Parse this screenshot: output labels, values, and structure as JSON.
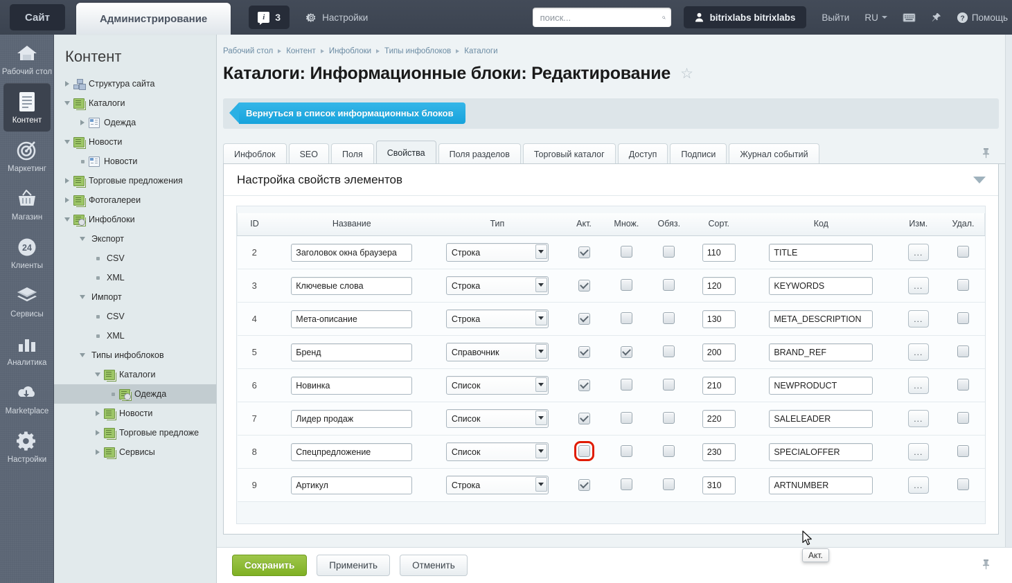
{
  "topbar": {
    "site_tab": "Сайт",
    "admin_tab": "Администрирование",
    "notif_count": "3",
    "notif_icon": "info-badge-icon",
    "settings_label": "Настройки",
    "settings_icon": "gear-icon",
    "search_placeholder": "поиск...",
    "search_value": "",
    "search_icon": "search-icon",
    "user_name": "bitrixlabs bitrixlabs",
    "user_icon": "user-icon",
    "logout_label": "Выйти",
    "lang_label": "RU",
    "keyboard_icon": "keyboard-icon",
    "pin_icon": "pin-icon",
    "help_label": "Помощь",
    "help_icon": "question-circle-icon"
  },
  "rail": {
    "items": [
      {
        "label": "Рабочий стол",
        "icon": "home-icon",
        "selected": false
      },
      {
        "label": "Контент",
        "icon": "document-icon",
        "selected": true
      },
      {
        "label": "Маркетинг",
        "icon": "target-icon",
        "selected": false
      },
      {
        "label": "Магазин",
        "icon": "basket-icon",
        "selected": false
      },
      {
        "label": "Клиенты",
        "icon": "badge-24-icon",
        "selected": false
      },
      {
        "label": "Сервисы",
        "icon": "layers-icon",
        "selected": false
      },
      {
        "label": "Аналитика",
        "icon": "bar-chart-icon",
        "selected": false
      },
      {
        "label": "Marketplace",
        "icon": "cloud-download-icon",
        "selected": false
      },
      {
        "label": "Настройки",
        "icon": "gear-icon",
        "selected": false
      }
    ]
  },
  "sidebar": {
    "title": "Контент",
    "nodes": [
      {
        "label": "Структура сайта",
        "indent": 0,
        "marker": "right",
        "icon": "site-structure-icon",
        "selected": false
      },
      {
        "label": "Каталоги",
        "indent": 0,
        "marker": "down",
        "icon": "green-folder-icon",
        "selected": false
      },
      {
        "label": "Одежда",
        "indent": 1,
        "marker": "right",
        "icon": "page-icon",
        "selected": false
      },
      {
        "label": "Новости",
        "indent": 0,
        "marker": "down",
        "icon": "green-folder-icon",
        "selected": false
      },
      {
        "label": "Новости",
        "indent": 1,
        "marker": "dot",
        "icon": "page-icon",
        "selected": false
      },
      {
        "label": "Торговые предложения",
        "indent": 0,
        "marker": "right",
        "icon": "green-folder-icon",
        "selected": false
      },
      {
        "label": "Фотогалереи",
        "indent": 0,
        "marker": "right",
        "icon": "green-folder-icon",
        "selected": false
      },
      {
        "label": "Инфоблоки",
        "indent": 0,
        "marker": "down",
        "icon": "green-folder-gear-icon",
        "selected": false
      },
      {
        "label": "Экспорт",
        "indent": 1,
        "marker": "down",
        "icon": "none",
        "selected": false
      },
      {
        "label": "CSV",
        "indent": 2,
        "marker": "dot",
        "icon": "none",
        "selected": false
      },
      {
        "label": "XML",
        "indent": 2,
        "marker": "dot",
        "icon": "none",
        "selected": false
      },
      {
        "label": "Импорт",
        "indent": 1,
        "marker": "down",
        "icon": "none",
        "selected": false
      },
      {
        "label": "CSV",
        "indent": 2,
        "marker": "dot",
        "icon": "none",
        "selected": false
      },
      {
        "label": "XML",
        "indent": 2,
        "marker": "dot",
        "icon": "none",
        "selected": false
      },
      {
        "label": "Типы инфоблоков",
        "indent": 1,
        "marker": "down",
        "icon": "none",
        "selected": false
      },
      {
        "label": "Каталоги",
        "indent": 2,
        "marker": "down",
        "icon": "green-folder-icon",
        "selected": false
      },
      {
        "label": "Одежда",
        "indent": 3,
        "marker": "dot",
        "icon": "green-folder-gear-icon",
        "selected": true
      },
      {
        "label": "Новости",
        "indent": 2,
        "marker": "right",
        "icon": "green-folder-icon",
        "selected": false
      },
      {
        "label": "Торговые предложе",
        "indent": 2,
        "marker": "right",
        "icon": "green-folder-icon",
        "selected": false
      },
      {
        "label": "Сервисы",
        "indent": 2,
        "marker": "right",
        "icon": "green-folder-icon",
        "selected": false
      }
    ]
  },
  "breadcrumbs": [
    "Рабочий стол",
    "Контент",
    "Инфоблоки",
    "Типы инфоблоков",
    "Каталоги"
  ],
  "page": {
    "title": "Каталоги: Информационные блоки: Редактирование",
    "favorite_icon": "star-outline-icon",
    "back_button": "Вернуться в список информационных блоков",
    "pin_icon": "pin-icon"
  },
  "tabs": [
    {
      "label": "Инфоблок",
      "active": false
    },
    {
      "label": "SEO",
      "active": false
    },
    {
      "label": "Поля",
      "active": false
    },
    {
      "label": "Свойства",
      "active": true
    },
    {
      "label": "Поля разделов",
      "active": false
    },
    {
      "label": "Торговый каталог",
      "active": false
    },
    {
      "label": "Доступ",
      "active": false
    },
    {
      "label": "Подписи",
      "active": false
    },
    {
      "label": "Журнал событий",
      "active": false
    }
  ],
  "card": {
    "title": "Настройка свойств элементов",
    "collapse_icon": "chevron-down-icon"
  },
  "table": {
    "headers": [
      "ID",
      "Название",
      "Тип",
      "Акт.",
      "Множ.",
      "Обяз.",
      "Сорт.",
      "Код",
      "Изм.",
      "Удал."
    ],
    "edit_button_label": "...",
    "rows": [
      {
        "id": "2",
        "name": "Заголовок окна браузера",
        "type": "Строка",
        "active": true,
        "multiple": false,
        "required": false,
        "sort": "110",
        "code": "TITLE",
        "delete": false,
        "highlight": false
      },
      {
        "id": "3",
        "name": "Ключевые слова",
        "type": "Строка",
        "active": true,
        "multiple": false,
        "required": false,
        "sort": "120",
        "code": "KEYWORDS",
        "delete": false,
        "highlight": false
      },
      {
        "id": "4",
        "name": "Мета-описание",
        "type": "Строка",
        "active": true,
        "multiple": false,
        "required": false,
        "sort": "130",
        "code": "META_DESCRIPTION",
        "delete": false,
        "highlight": false
      },
      {
        "id": "5",
        "name": "Бренд",
        "type": "Справочник",
        "active": true,
        "multiple": true,
        "required": false,
        "sort": "200",
        "code": "BRAND_REF",
        "delete": false,
        "highlight": false
      },
      {
        "id": "6",
        "name": "Новинка",
        "type": "Список",
        "active": true,
        "multiple": false,
        "required": false,
        "sort": "210",
        "code": "NEWPRODUCT",
        "delete": false,
        "highlight": false
      },
      {
        "id": "7",
        "name": "Лидер продаж",
        "type": "Список",
        "active": true,
        "multiple": false,
        "required": false,
        "sort": "220",
        "code": "SALELEADER",
        "delete": false,
        "highlight": false
      },
      {
        "id": "8",
        "name": "Спецпредложение",
        "type": "Список",
        "active": false,
        "multiple": false,
        "required": false,
        "sort": "230",
        "code": "SPECIALOFFER",
        "delete": false,
        "highlight": true
      },
      {
        "id": "9",
        "name": "Артикул",
        "type": "Строка",
        "active": true,
        "multiple": false,
        "required": false,
        "sort": "310",
        "code": "ARTNUMBER",
        "delete": false,
        "highlight": false
      }
    ]
  },
  "tooltip": {
    "text": "Акт."
  },
  "savebar": {
    "save": "Сохранить",
    "apply": "Применить",
    "cancel": "Отменить",
    "pin_icon": "pin-icon"
  },
  "colors": {
    "accent_blue": "#17a3dc",
    "accent_green": "#7fb024",
    "highlight_red": "#e01b00",
    "topbar_dark": "#3f4753",
    "sidebar_bg": "#e2eaec"
  }
}
